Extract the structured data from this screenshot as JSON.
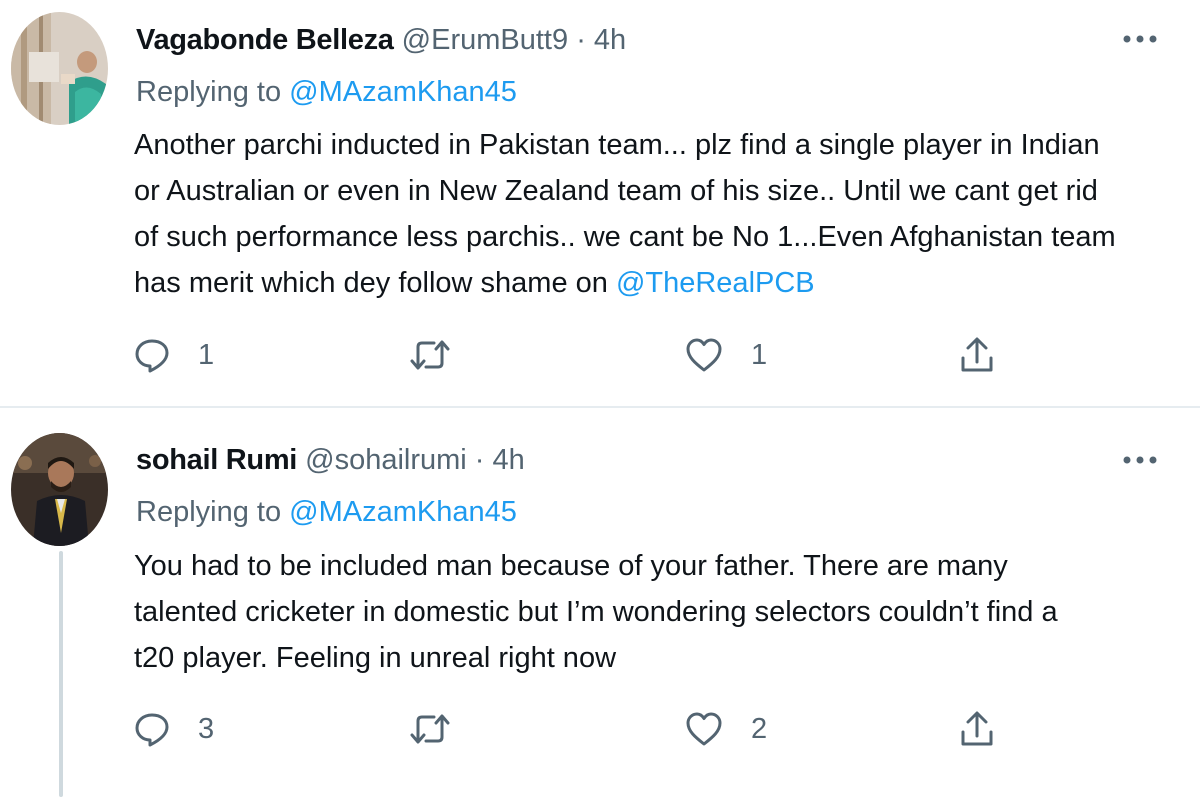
{
  "tweets": [
    {
      "display_name": "Vagabonde Belleza",
      "handle": "@ErumButt9",
      "separator": "·",
      "time": "4h",
      "replying_prefix": "Replying to",
      "replying_to": "@MAzamKhan45",
      "text_lines": [
        "Another parchi inducted in Pakistan team... plz find a single player in Indian",
        "or Australian or even in New Zealand team of his size.. Until we cant get rid",
        "of such performance less parchis.. we cant be No 1...Even Afghanistan team",
        "has merit which dey follow shame on "
      ],
      "text_mention": "@TheRealPCB",
      "actions": {
        "reply_icon": "reply-bubble-icon",
        "reply_count": "1",
        "retweet_icon": "retweet-icon",
        "retweet_count": "",
        "like_icon": "heart-icon",
        "like_count": "1",
        "share_icon": "share-upload-icon"
      },
      "more_icon": "more-dots-icon"
    },
    {
      "display_name": "sohail Rumi",
      "handle": "@sohailrumi",
      "separator": "·",
      "time": "4h",
      "replying_prefix": "Replying to",
      "replying_to": "@MAzamKhan45",
      "text_lines": [
        "You had to be included man because of your father. There are many",
        "talented cricketer in domestic but I’m wondering selectors couldn’t find a",
        "t20 player. Feeling in unreal right now"
      ],
      "actions": {
        "reply_icon": "reply-bubble-icon",
        "reply_count": "3",
        "retweet_icon": "retweet-icon",
        "retweet_count": "",
        "like_icon": "heart-icon",
        "like_count": "2",
        "share_icon": "share-upload-icon"
      },
      "more_icon": "more-dots-icon"
    }
  ],
  "colors": {
    "link": "#1d9bf0",
    "secondary_text": "#536471",
    "primary_text": "#0f1419",
    "divider": "#e6ecf0",
    "thread_line": "#cfd9de"
  }
}
